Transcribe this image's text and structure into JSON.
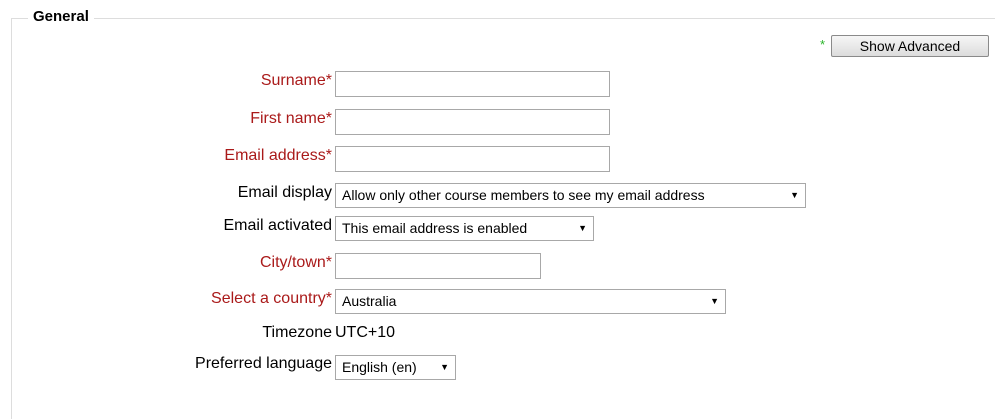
{
  "section": {
    "title": "General"
  },
  "advanced": {
    "star": "*",
    "button_label": "Show Advanced"
  },
  "fields": {
    "surname": {
      "label": "Surname*",
      "value": ""
    },
    "firstname": {
      "label": "First name*",
      "value": ""
    },
    "email": {
      "label": "Email address*",
      "value": ""
    },
    "email_display": {
      "label": "Email display",
      "selected": "Allow only other course members to see my email address"
    },
    "email_activated": {
      "label": "Email activated",
      "selected": "This email address is enabled"
    },
    "city": {
      "label": "City/town*",
      "value": ""
    },
    "country": {
      "label": "Select a country*",
      "selected": "Australia"
    },
    "timezone": {
      "label": "Timezone",
      "value": "UTC+10"
    },
    "language": {
      "label": "Preferred language",
      "selected": "English (en)"
    }
  },
  "colors": {
    "required_label": "#aa1a1a",
    "advanced_star": "#2ab52a",
    "border": "#a8a8a8"
  },
  "icons": {
    "dropdown": "triangle-down"
  }
}
